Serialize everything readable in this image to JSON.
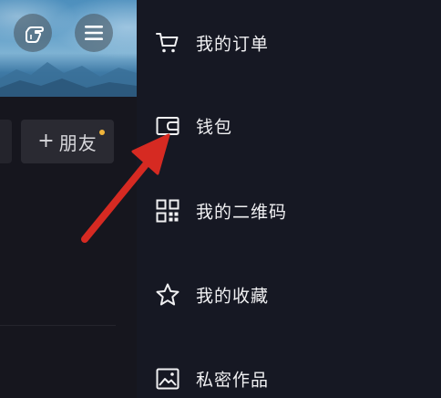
{
  "profile": {
    "friend_button": {
      "plus": "+",
      "label": "朋友"
    }
  },
  "drawer": {
    "items": [
      {
        "label": "我的订单",
        "icon": "shopping-cart-icon"
      },
      {
        "label": "钱包",
        "icon": "wallet-icon"
      },
      {
        "label": "我的二维码",
        "icon": "qr-code-icon"
      },
      {
        "label": "我的收藏",
        "icon": "star-icon"
      },
      {
        "label": "私密作品",
        "icon": "private-image-icon"
      }
    ]
  },
  "colors": {
    "background": "#16161e",
    "drawer_background": "#161823",
    "text": "#f0f0f2",
    "notification_dot": "#f0b43a",
    "annotation_arrow": "#d62a22"
  }
}
